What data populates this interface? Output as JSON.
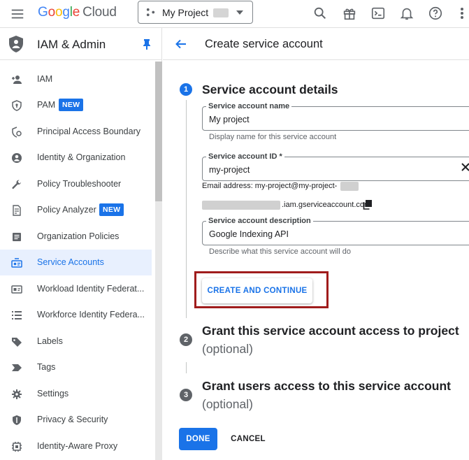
{
  "topbar": {
    "logo_google": [
      "G",
      "o",
      "o",
      "g",
      "l",
      "e"
    ],
    "logo_cloud": "Cloud",
    "project_name": "My Project",
    "icons": [
      "menu-icon",
      "search-icon",
      "gift-icon",
      "cloud-shell-icon",
      "bell-icon",
      "help-icon",
      "more-vert-icon"
    ]
  },
  "sidebar": {
    "title": "IAM & Admin",
    "items": [
      {
        "label": "IAM",
        "icon": "person-add-icon"
      },
      {
        "label": "PAM",
        "icon": "pam-shield-icon",
        "badge": "NEW"
      },
      {
        "label": "Principal Access Boundary",
        "icon": "boundary-icon"
      },
      {
        "label": "Identity & Organization",
        "icon": "account-circle-icon"
      },
      {
        "label": "Policy Troubleshooter",
        "icon": "wrench-icon"
      },
      {
        "label": "Policy Analyzer",
        "icon": "policy-doc-icon",
        "badge": "NEW"
      },
      {
        "label": "Organization Policies",
        "icon": "org-policy-icon"
      },
      {
        "label": "Service Accounts",
        "icon": "service-account-icon",
        "active": true
      },
      {
        "label": "Workload Identity Federat...",
        "icon": "id-card-icon"
      },
      {
        "label": "Workforce Identity Federa...",
        "icon": "list-icon"
      },
      {
        "label": "Labels",
        "icon": "label-icon"
      },
      {
        "label": "Tags",
        "icon": "tag-icon"
      },
      {
        "label": "Settings",
        "icon": "gear-icon"
      },
      {
        "label": "Privacy & Security",
        "icon": "shield-icon"
      },
      {
        "label": "Identity-Aware Proxy",
        "icon": "proxy-icon"
      }
    ]
  },
  "main": {
    "page_title": "Create service account",
    "step1": {
      "number": "1",
      "title": "Service account details",
      "name_field": {
        "label": "Service account name",
        "value": "My project",
        "helper": "Display name for this service account"
      },
      "id_field": {
        "label": "Service account ID *",
        "value": "my-project"
      },
      "email_prefix": "Email address: my-project@my-project-",
      "email_domain": ".iam.gserviceaccount.com",
      "desc_field": {
        "label": "Service account description",
        "value": "Google Indexing API",
        "helper": "Describe what this service account will do"
      },
      "create_button": "CREATE AND CONTINUE"
    },
    "step2": {
      "number": "2",
      "title": "Grant this service account access to project",
      "optional": "(optional)"
    },
    "step3": {
      "number": "3",
      "title": "Grant users access to this service account",
      "optional": "(optional)"
    },
    "done_button": "DONE",
    "cancel_button": "CANCEL"
  },
  "colors": {
    "accent": "#1a73e8",
    "highlight_box": "#a01c1c",
    "active_bg": "#e8f0fe"
  }
}
